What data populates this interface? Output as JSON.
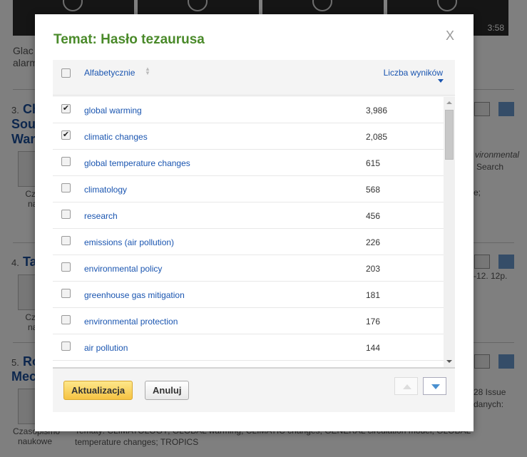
{
  "background": {
    "video_duration": "3:58",
    "snippets": [
      "Glac",
      "alarm"
    ],
    "results": [
      {
        "num": "3.",
        "title": [
          "Ch",
          "Sou",
          "War"
        ],
        "type": [
          "Czas",
          "nau"
        ],
        "right_text": [
          "vironmental",
          "Search",
          "e;"
        ]
      },
      {
        "num": "4.",
        "title": [
          "Ta"
        ],
        "type": [
          "Czas",
          "nau"
        ],
        "right_text": [
          "-12. 12p."
        ]
      },
      {
        "num": "5.",
        "title": [
          "Ro",
          "Mec"
        ],
        "type": [
          "Czasopismo",
          "naukowe"
        ],
        "right_text": [
          "28 Issue",
          "danych:"
        ],
        "topics_line1": "Tematy: CLIMATOLOGY; GLOBAL warming; CLIMATIC changes; GENERAL circulation model; GLOBAL",
        "topics_line2": "temperature changes; TROPICS"
      }
    ]
  },
  "modal": {
    "title": "Temat: Hasło tezaurusa",
    "close": "X",
    "header": {
      "sort_alpha": "Alfabetycznie",
      "sort_count": "Liczba wyników"
    },
    "items": [
      {
        "label": "global warming",
        "count": "3,986",
        "checked": true
      },
      {
        "label": "climatic changes",
        "count": "2,085",
        "checked": true
      },
      {
        "label": "global temperature changes",
        "count": "615",
        "checked": false
      },
      {
        "label": "climatology",
        "count": "568",
        "checked": false
      },
      {
        "label": "research",
        "count": "456",
        "checked": false
      },
      {
        "label": "emissions (air pollution)",
        "count": "226",
        "checked": false
      },
      {
        "label": "environmental policy",
        "count": "203",
        "checked": false
      },
      {
        "label": "greenhouse gas mitigation",
        "count": "181",
        "checked": false
      },
      {
        "label": "environmental protection",
        "count": "176",
        "checked": false
      },
      {
        "label": "air pollution",
        "count": "144",
        "checked": false
      }
    ],
    "update_label": "Aktualizacja",
    "cancel_label": "Anuluj"
  }
}
